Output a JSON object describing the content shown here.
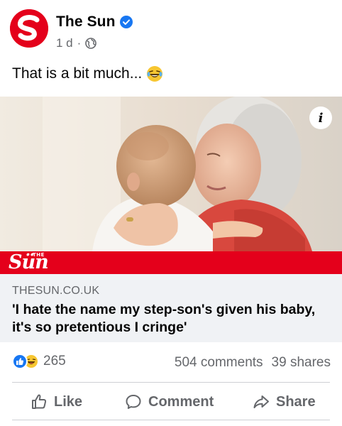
{
  "post": {
    "page_name": "The Sun",
    "age": "1 d",
    "separator": "·",
    "text": "That is a bit much...",
    "text_emoji": "laughing-tears-emoji"
  },
  "link": {
    "image_brand_sub": "THE",
    "image_brand_word": "Sün",
    "domain": "THESUN.CO.UK",
    "headline": "'I hate the name my step-son's given his baby, it's so pretentious I cringe'"
  },
  "stats": {
    "reaction_count": "265",
    "comments": "504 comments",
    "shares": "39 shares"
  },
  "actions": {
    "like": "Like",
    "comment": "Comment",
    "share": "Share"
  },
  "icons": {
    "logo": "the-sun-logo",
    "verified": "verified-badge-icon",
    "audience": "globe-icon",
    "info": "info-icon"
  },
  "colors": {
    "brand_red": "#e4001b",
    "facebook_blue": "#1877f2",
    "secondary_text": "#65676b",
    "link_bg": "#f0f2f5"
  }
}
